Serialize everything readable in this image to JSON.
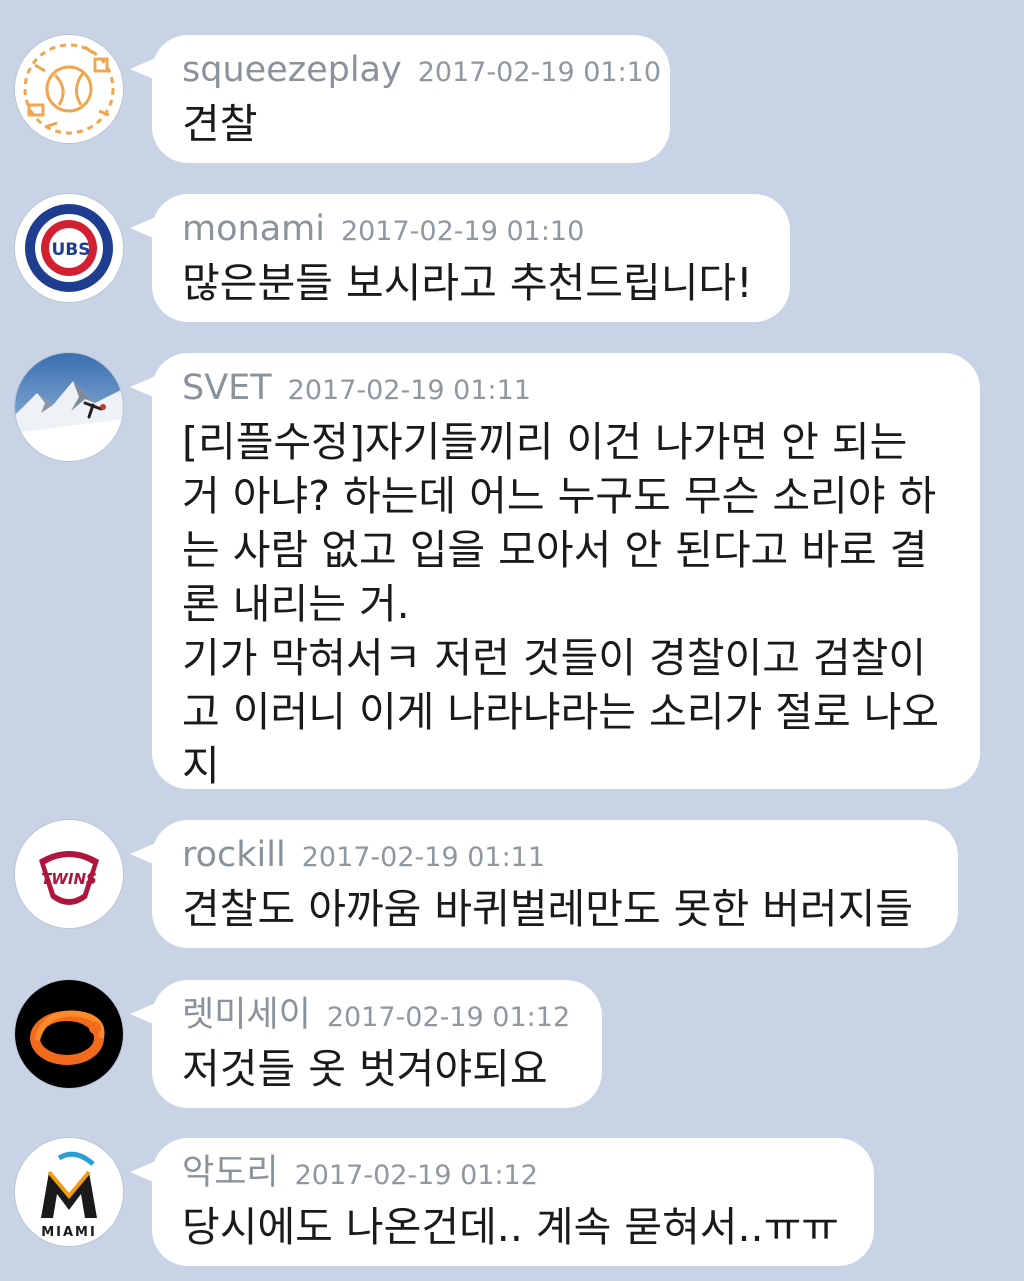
{
  "comments": [
    {
      "username": "squeezeplay",
      "timestamp": "2017-02-19 01:10",
      "text": "견찰",
      "avatar_icon": "baseball-doodle-icon"
    },
    {
      "username": "monami",
      "timestamp": "2017-02-19 01:10",
      "text": "많은분들 보시라고 추천드립니다!",
      "avatar_icon": "cubs-logo-icon",
      "avatar_label": "UBS"
    },
    {
      "username": "SVET",
      "timestamp": "2017-02-19 01:11",
      "text": "[리플수정]자기들끼리 이건 나가면 안 되는\n거 아냐? 하는데 어느 누구도 무슨 소리야 하\n는 사람 없고 입을 모아서 안 된다고 바로 결\n론 내리는 거.\n기가 막혀서ㅋ 저런 것들이 경찰이고 검찰이\n고 이러니 이게 나라냐라는 소리가 절로 나오\n지",
      "avatar_icon": "skier-photo-icon"
    },
    {
      "username": "rockill",
      "timestamp": "2017-02-19 01:11",
      "text": "견찰도 아까움 바퀴벌레만도 못한 버러지들",
      "avatar_icon": "lg-twins-logo-icon",
      "avatar_label": "TWINS"
    },
    {
      "username": "렛미세이",
      "timestamp": "2017-02-19 01:12",
      "text": "저것들 옷 벗겨야되요",
      "avatar_icon": "orange-swirl-icon"
    },
    {
      "username": "악도리",
      "timestamp": "2017-02-19 01:12",
      "text": "당시에도 나온건데.. 계속 묻혀서..ㅠㅠ",
      "avatar_icon": "marlins-logo-icon",
      "avatar_label": "MIAMI"
    }
  ],
  "colors": {
    "background": "#c8d4e6",
    "bubble": "#ffffff",
    "meta": "#8a929a",
    "message": "#1a1a1a"
  }
}
